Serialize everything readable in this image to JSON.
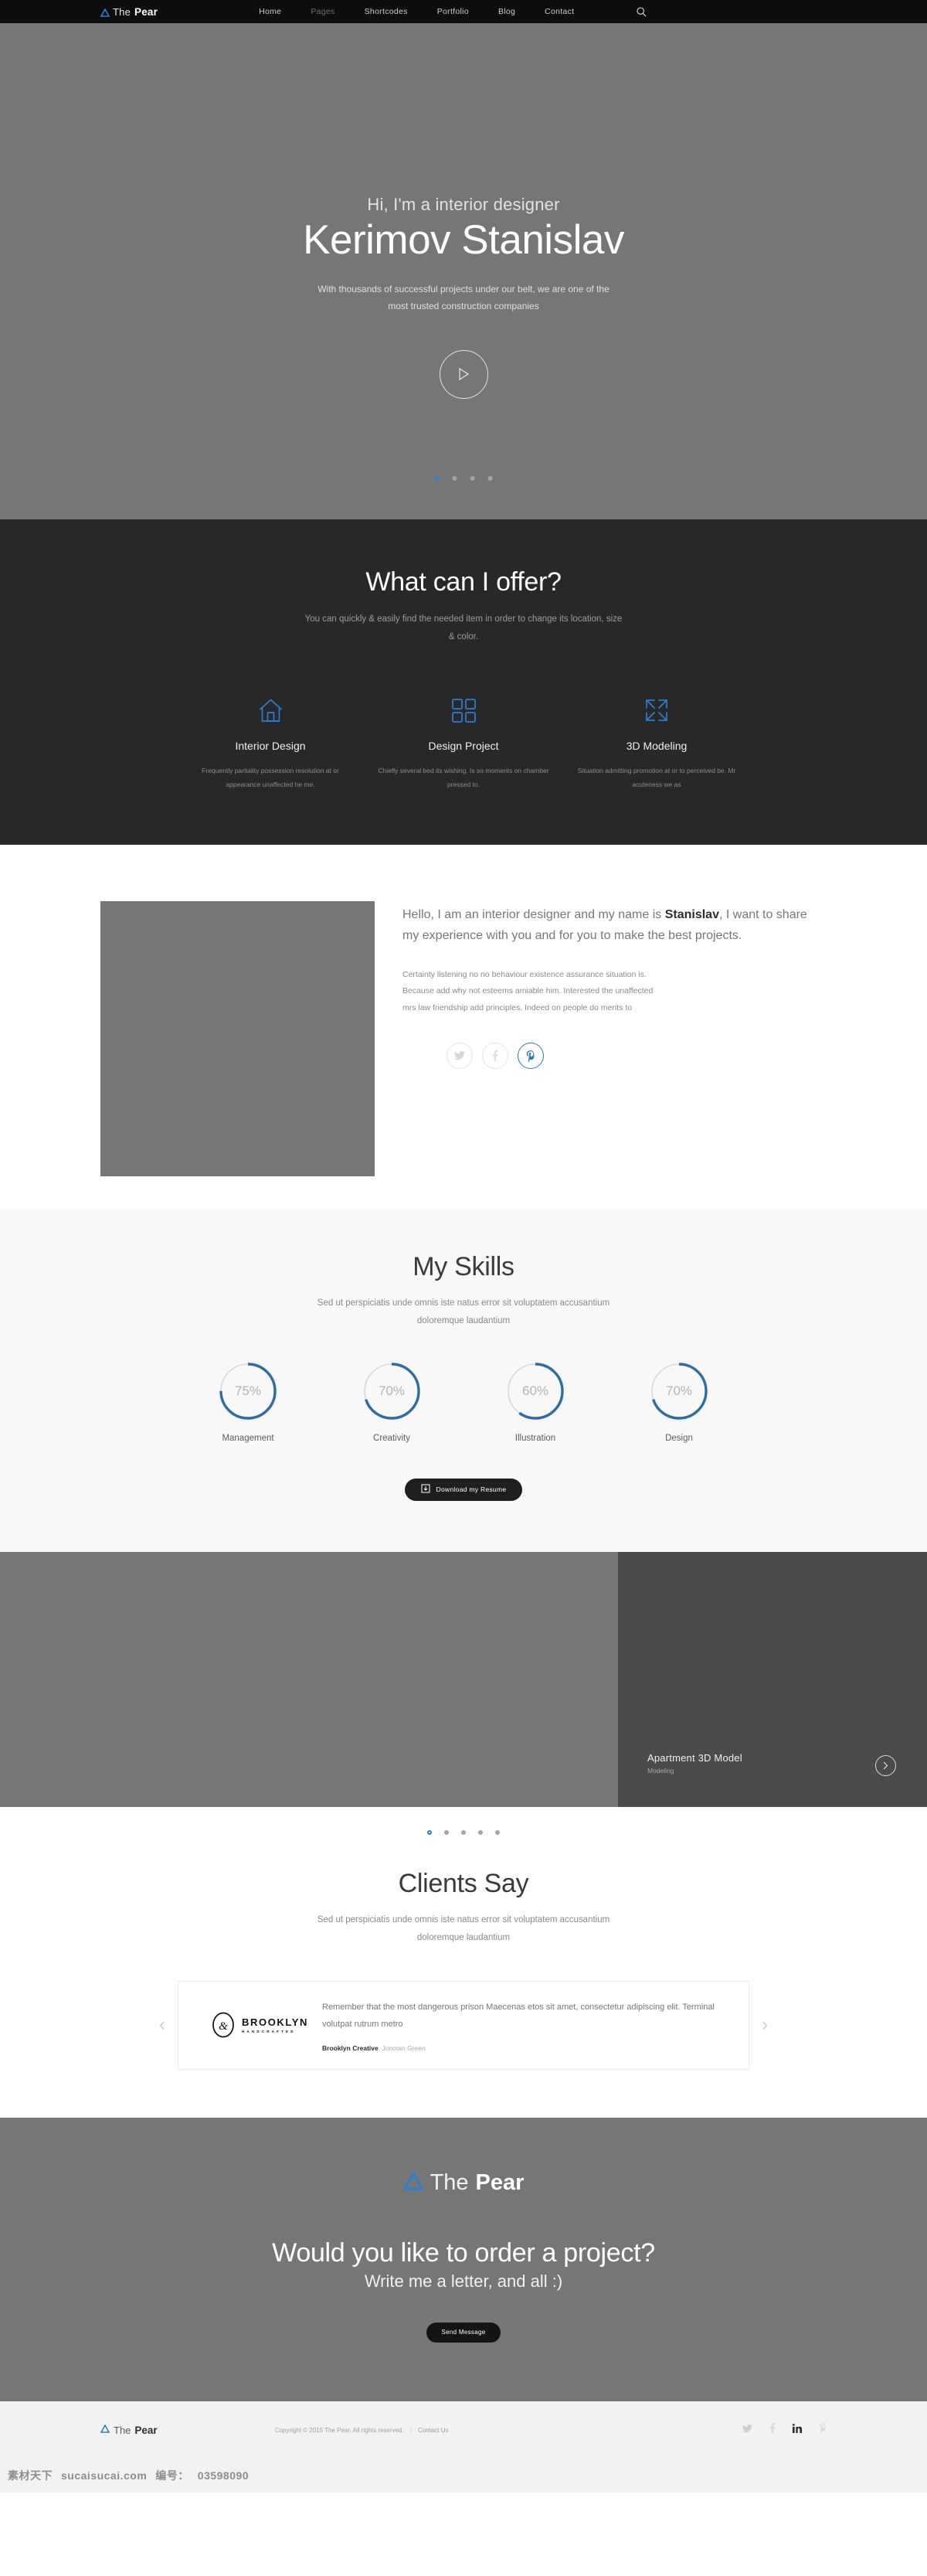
{
  "nav": {
    "logo": {
      "the": "The",
      "pear": "Pear",
      "mark": "triangle-logo-icon"
    },
    "links": [
      {
        "label": "Home",
        "dim": false
      },
      {
        "label": "Pages",
        "dim": true
      },
      {
        "label": "Shortcodes",
        "dim": false
      },
      {
        "label": "Portfolio",
        "dim": false
      },
      {
        "label": "Blog",
        "dim": false
      },
      {
        "label": "Contact",
        "dim": false
      }
    ],
    "search_icon": "search-icon"
  },
  "hero": {
    "subtitle": "Hi, I'm a interior designer",
    "title": "Kerimov Stanislav",
    "description": "With thousands of successful projects under our belt, we are one of the most trusted construction companies",
    "play_icon": "play-icon",
    "dots": 4,
    "active_dot": 0
  },
  "services": {
    "title": "What can I offer?",
    "subtitle": "You can quickly & easily find the needed item in order to change its location, size & color.",
    "items": [
      {
        "icon": "home-icon",
        "name": "Interior Design",
        "text": "Frequently partiality possession resolution at or appearance unaffected he me."
      },
      {
        "icon": "grid-icon",
        "name": "Design Project",
        "text": "Chiefly several bed its wishing. Is so moments on chamber pressed to."
      },
      {
        "icon": "expand-arrows-icon",
        "name": "3D Modeling",
        "text": "Situation admitting promotion at or to perceived be. Mr acuteness we as"
      }
    ]
  },
  "about": {
    "image_alt": "designer-portrait",
    "lead_before": "Hello, I am an interior designer and my name is ",
    "lead_bold": "Stanislav",
    "lead_after": ", I want to share my experience with you and for you to make the best projects.",
    "body": "Certainty listening no no behaviour existence assurance situation is. Because add why not esteems amiable him. Interested the unaffected mrs law friendship add principles. Indeed on people do merits to",
    "socials": [
      {
        "icon": "twitter-icon",
        "active": false
      },
      {
        "icon": "facebook-icon",
        "active": false
      },
      {
        "icon": "pinterest-icon",
        "active": true
      }
    ]
  },
  "skills": {
    "title": "My Skills",
    "subtitle": "Sed ut perspiciatis unde omnis iste natus error sit voluptatem accusantium doloremque laudantium",
    "resume_button": "Download my Resume",
    "resume_icon": "download-icon"
  },
  "chart_data": {
    "type": "pie",
    "title": "My Skills",
    "chart_variant": "radial-progress-rings",
    "categories": [
      "Management",
      "Creativity",
      "Illustration",
      "Design"
    ],
    "values": [
      75,
      70,
      60,
      70
    ],
    "labels": [
      "75%",
      "70%",
      "60%",
      "70%"
    ],
    "unit": "%",
    "ylim": [
      0,
      100
    ],
    "track_color": "#d8d8d8",
    "arc_color": "#2e6da4"
  },
  "portfolio": {
    "title": "Apartment  3D Model",
    "category": "Modeling",
    "arrow_icon": "chevron-right-icon",
    "dots": 5,
    "active_dot": 0
  },
  "testimonials": {
    "title": "Clients Say",
    "subtitle": "Sed ut perspiciatis unde omnis iste natus error sit voluptatem accusantium doloremque laudantium",
    "prev_icon": "chevron-left-icon",
    "next_icon": "chevron-right-icon",
    "brand_mark": "brooklyn-ampersand-icon",
    "brand_name": "BROOKLYN",
    "brand_tag": "HANDCRAFTED",
    "quote": "Remember that the most dangerous prison Maecenas etos sit amet, consectetur adipiscing elit. Terminal volutpat rutrum metro",
    "author_company": "Brooklyn Creative",
    "author_name": ", Jonotan Green"
  },
  "cta": {
    "logo_the": "The",
    "logo_pear": "Pear",
    "heading": "Would you like to order a project?",
    "subheading": "Write me a letter, and all :)",
    "button": "Send Message"
  },
  "footer": {
    "logo_the": "The",
    "logo_pear": "Pear",
    "copyright": "Copyright © 2015 The Pear. All rights reserved.",
    "separator": "|",
    "contact_link": "Contact Us",
    "socials": [
      {
        "icon": "twitter-icon",
        "muted": true
      },
      {
        "icon": "facebook-icon",
        "muted": true
      },
      {
        "icon": "linkedin-icon",
        "muted": false
      },
      {
        "icon": "pinterest-icon",
        "muted": true
      }
    ]
  },
  "watermark": {
    "site_cn": "素材天下",
    "site": "sucaisucai.com",
    "id_label": "编号：",
    "id_value": "03598090"
  },
  "colors": {
    "accent": "#2a7fd4",
    "dark_section": "#282828",
    "gray_photo": "#767676",
    "portfolio_panel": "#4b4b4b",
    "skills_bg": "#f8f8f8",
    "footer_bg": "#f2f2f2"
  }
}
